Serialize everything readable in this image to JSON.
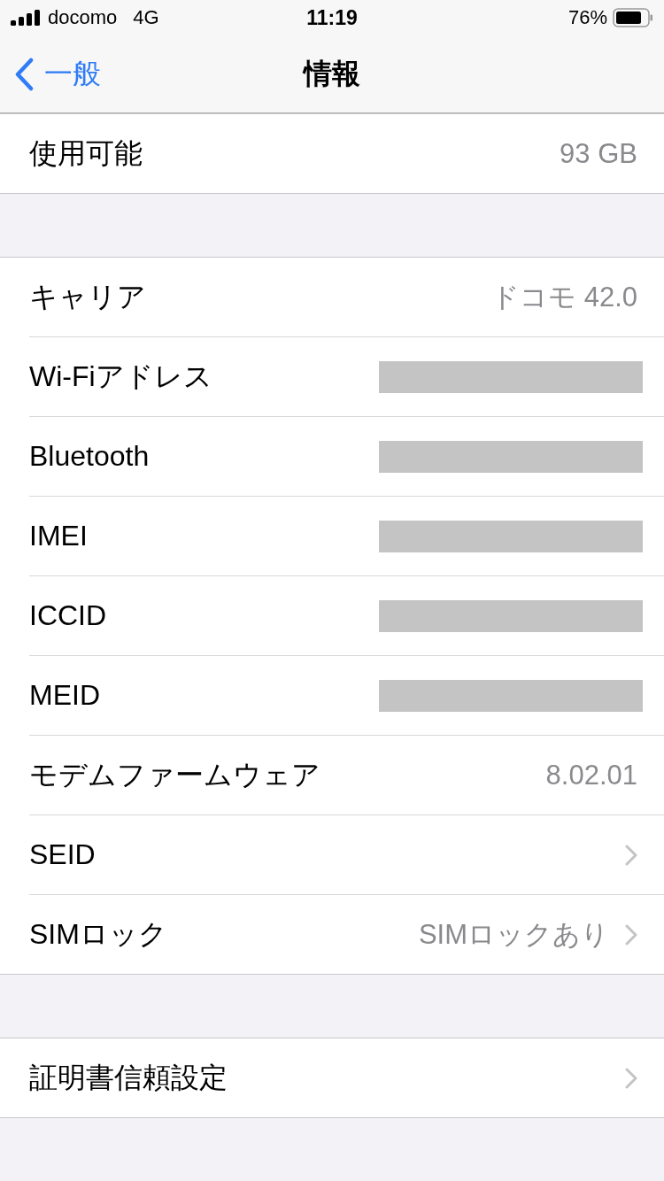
{
  "status_bar": {
    "carrier": "docomo",
    "network": "4G",
    "time": "11:19",
    "battery": "76%"
  },
  "nav": {
    "back": "一般",
    "title": "情報"
  },
  "groups": [
    {
      "rows": [
        {
          "kind": "value",
          "label": "使用可能",
          "value": "93 GB"
        }
      ]
    },
    {
      "rows": [
        {
          "kind": "value",
          "label": "キャリア",
          "value": "ドコモ 42.0"
        },
        {
          "kind": "redacted",
          "label": "Wi-Fiアドレス"
        },
        {
          "kind": "redacted",
          "label": "Bluetooth"
        },
        {
          "kind": "redacted",
          "label": "IMEI"
        },
        {
          "kind": "redacted",
          "label": "ICCID"
        },
        {
          "kind": "redacted",
          "label": "MEID"
        },
        {
          "kind": "value",
          "label": "モデムファームウェア",
          "value": "8.02.01"
        },
        {
          "kind": "link",
          "label": "SEID"
        },
        {
          "kind": "link",
          "label": "SIMロック",
          "value": "SIMロックあり"
        }
      ]
    },
    {
      "rows": [
        {
          "kind": "link",
          "label": "証明書信頼設定"
        }
      ]
    }
  ]
}
